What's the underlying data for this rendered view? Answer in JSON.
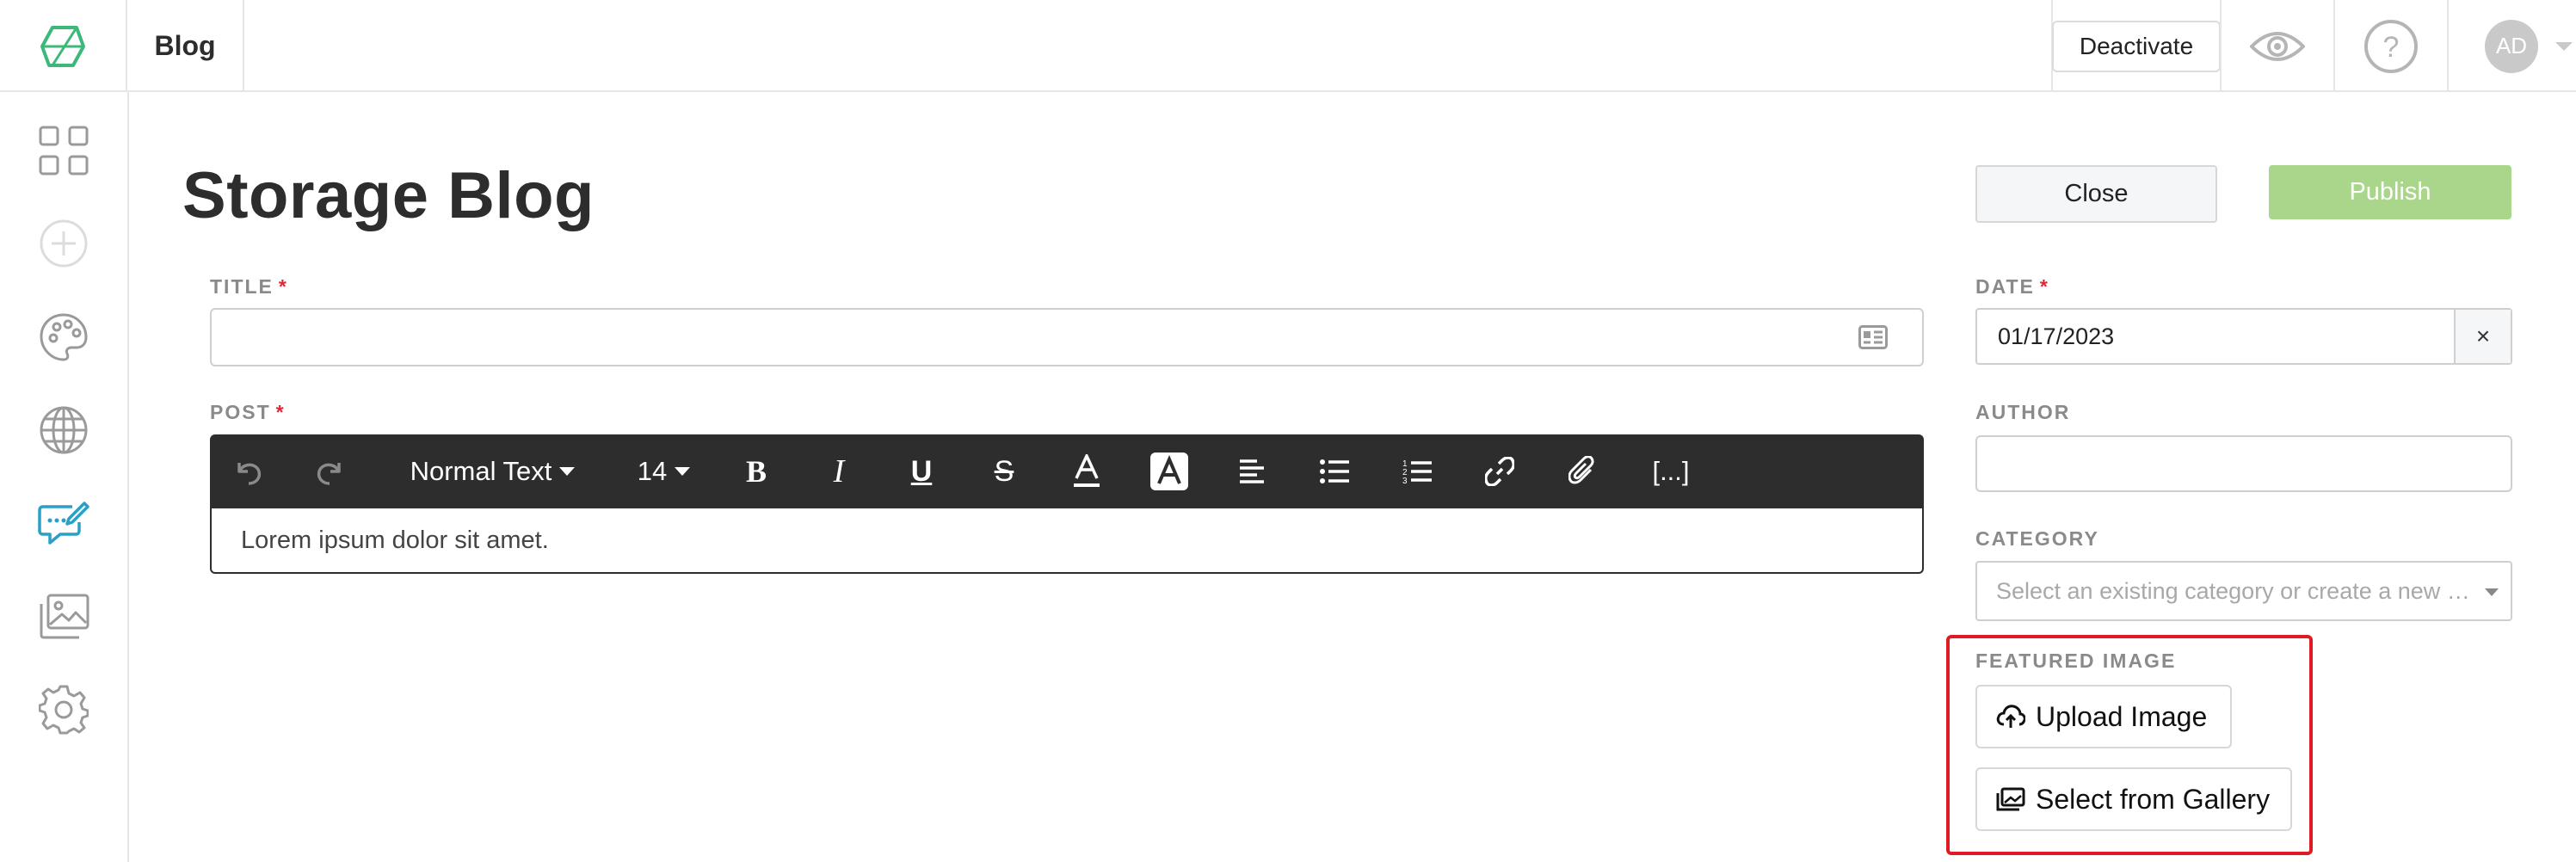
{
  "header": {
    "section_title": "Blog",
    "deactivate_label": "Deactivate",
    "avatar_initials": "AD"
  },
  "sidebar": {
    "items": [
      {
        "icon": "grid-icon"
      },
      {
        "icon": "plus-circle-icon"
      },
      {
        "icon": "palette-icon"
      },
      {
        "icon": "globe-icon"
      },
      {
        "icon": "blog-edit-icon",
        "active": true
      },
      {
        "icon": "images-icon"
      },
      {
        "icon": "gear-icon"
      }
    ]
  },
  "main": {
    "page_title": "Storage Blog",
    "title_label": "TITLE",
    "title_value": "",
    "post_label": "POST",
    "required_mark": "*",
    "toolbar": {
      "text_style": "Normal Text",
      "font_size": "14",
      "more_label": "[...]"
    },
    "post_content": "Lorem ipsum dolor sit amet."
  },
  "right": {
    "close_label": "Close",
    "publish_label": "Publish",
    "date_label": "DATE",
    "date_value": "01/17/2023",
    "date_clear": "×",
    "author_label": "AUTHOR",
    "author_value": "",
    "category_label": "CATEGORY",
    "category_placeholder": "Select an existing category or create a new …",
    "featured_label": "FEATURED IMAGE",
    "upload_label": "Upload Image",
    "gallery_label": "Select from Gallery"
  },
  "colors": {
    "accent": "#2aa0c8",
    "publish": "#a9d68a",
    "highlight": "#e01a22",
    "required": "#e0283a"
  }
}
